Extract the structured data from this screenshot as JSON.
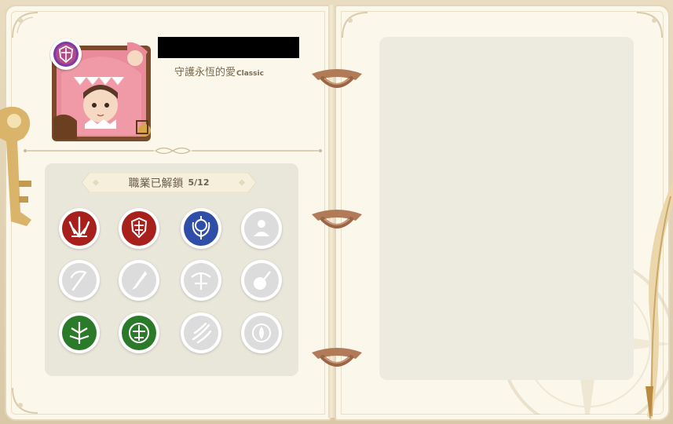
{
  "character": {
    "title": "守護永恆的愛",
    "title_tag": "Classic",
    "name_redacted": true
  },
  "jobs_panel": {
    "label": "職業已解鎖",
    "count": "5/12"
  },
  "jobs": [
    {
      "icon": "swordsman-icon",
      "unlocked": true,
      "color": "#a8201c"
    },
    {
      "icon": "knight-shield-icon",
      "unlocked": true,
      "color": "#a8201c"
    },
    {
      "icon": "mage-staff-icon",
      "unlocked": true,
      "color": "#2f4ea8"
    },
    {
      "icon": "cleric-icon",
      "unlocked": false,
      "color": "#dcdcdc"
    },
    {
      "icon": "scythe-icon",
      "unlocked": false,
      "color": "#dcdcdc"
    },
    {
      "icon": "dagger-icon",
      "unlocked": false,
      "color": "#dcdcdc"
    },
    {
      "icon": "crossbow-icon",
      "unlocked": false,
      "color": "#dcdcdc"
    },
    {
      "icon": "lute-icon",
      "unlocked": false,
      "color": "#dcdcdc"
    },
    {
      "icon": "ranger-icon",
      "unlocked": true,
      "color": "#2a7a2a"
    },
    {
      "icon": "warden-icon",
      "unlocked": true,
      "color": "#2a7a2a"
    },
    {
      "icon": "wind-blade-icon",
      "unlocked": false,
      "color": "#dcdcdc"
    },
    {
      "icon": "flame-orb-icon",
      "unlocked": false,
      "color": "#dcdcdc"
    }
  ],
  "colors": {
    "page": "#fbf7ea",
    "text": "#7b6a52",
    "locked": "#dcdcdc"
  }
}
